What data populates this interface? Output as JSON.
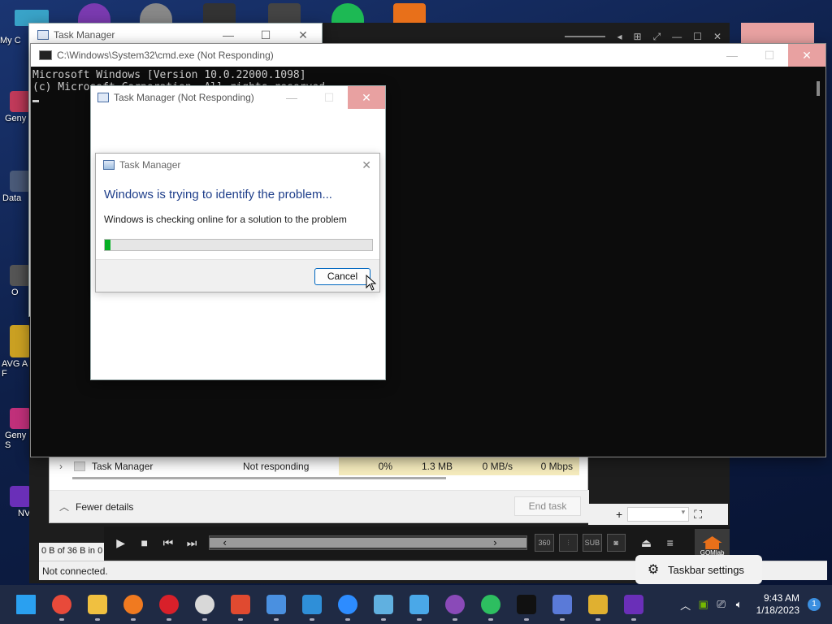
{
  "desktop": {
    "icons": [
      {
        "label": "My C",
        "color": "#39a3c8"
      },
      {
        "label": "Geny",
        "color": "#c03a5a"
      },
      {
        "label": "Data",
        "color": "#4a5a78"
      },
      {
        "label": "O",
        "color": "#555"
      },
      {
        "label": "AVG A F",
        "color": "#caa022"
      },
      {
        "label": "Geny S",
        "color": "#c0307a"
      },
      {
        "label": "NV",
        "color": "#6a2fb8"
      }
    ]
  },
  "task_manager_bg": {
    "title": "Task Manager",
    "row": {
      "name": "Task Manager",
      "status": "Not responding",
      "cpu": "0%",
      "memory": "1.3 MB",
      "disk": "0 MB/s",
      "network": "0 Mbps"
    },
    "fewer_details": "Fewer details",
    "end_task": "End task"
  },
  "cmd": {
    "title": "C:\\Windows\\System32\\cmd.exe (Not Responding)",
    "line1": "Microsoft Windows [Version 10.0.22000.1098]",
    "line2": "(c) Microsoft Corporation. All rights reserved."
  },
  "tm_not_responding": {
    "title": "Task Manager (Not Responding)"
  },
  "dialog": {
    "title": "Task Manager",
    "heading": "Windows is trying to identify the problem...",
    "message": "Windows is checking online for a solution to the problem",
    "progress": 0.02,
    "cancel": "Cancel"
  },
  "player": {
    "sub_label": "SUB",
    "brand": "GOMlab"
  },
  "download": {
    "status": "0 B of 36 B in 0",
    "connection": "Not connected."
  },
  "popup": {
    "label": "Taskbar settings"
  },
  "taskbar": {
    "apps": [
      {
        "name": "windows-start",
        "color": "#2aa0f0"
      },
      {
        "name": "chrome",
        "color": "#e84a3a"
      },
      {
        "name": "file-explorer",
        "color": "#f0c040"
      },
      {
        "name": "firefox",
        "color": "#f07a20"
      },
      {
        "name": "opera",
        "color": "#d8202a"
      },
      {
        "name": "clock-app",
        "color": "#d8d8d8"
      },
      {
        "name": "ccleaner",
        "color": "#e04a30"
      },
      {
        "name": "mail",
        "color": "#4a90e0"
      },
      {
        "name": "vscode",
        "color": "#2f8fd8"
      },
      {
        "name": "zoom",
        "color": "#2d8cff"
      },
      {
        "name": "paint",
        "color": "#60b0e0"
      },
      {
        "name": "notepad",
        "color": "#4aa8e8"
      },
      {
        "name": "github",
        "color": "#8a4ab8"
      },
      {
        "name": "evernote",
        "color": "#2dbe60"
      },
      {
        "name": "terminal",
        "color": "#111"
      },
      {
        "name": "blue-app",
        "color": "#5a7ad8"
      },
      {
        "name": "archive-app",
        "color": "#e0b030"
      },
      {
        "name": "nv-app",
        "color": "#6a2fb8"
      }
    ],
    "time": "9:43 AM",
    "date": "1/18/2023",
    "notification_count": "1"
  }
}
